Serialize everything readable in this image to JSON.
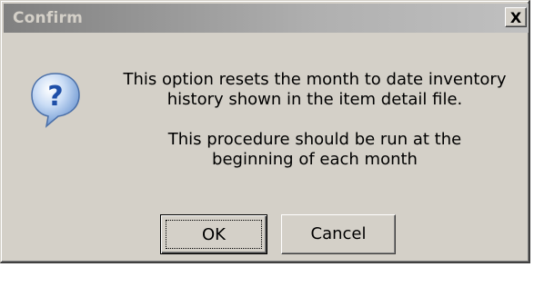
{
  "window": {
    "title": "Confirm",
    "close_glyph": "X"
  },
  "icon": {
    "name": "question-icon",
    "glyph": "?",
    "color": "#3a74c9"
  },
  "message": {
    "line1": "This option resets the month to date inventory",
    "line2": "history shown in the item detail file.",
    "line3": "This procedure should be run at the",
    "line4": "beginning of each month"
  },
  "buttons": {
    "ok_label": "OK",
    "cancel_label": "Cancel"
  }
}
